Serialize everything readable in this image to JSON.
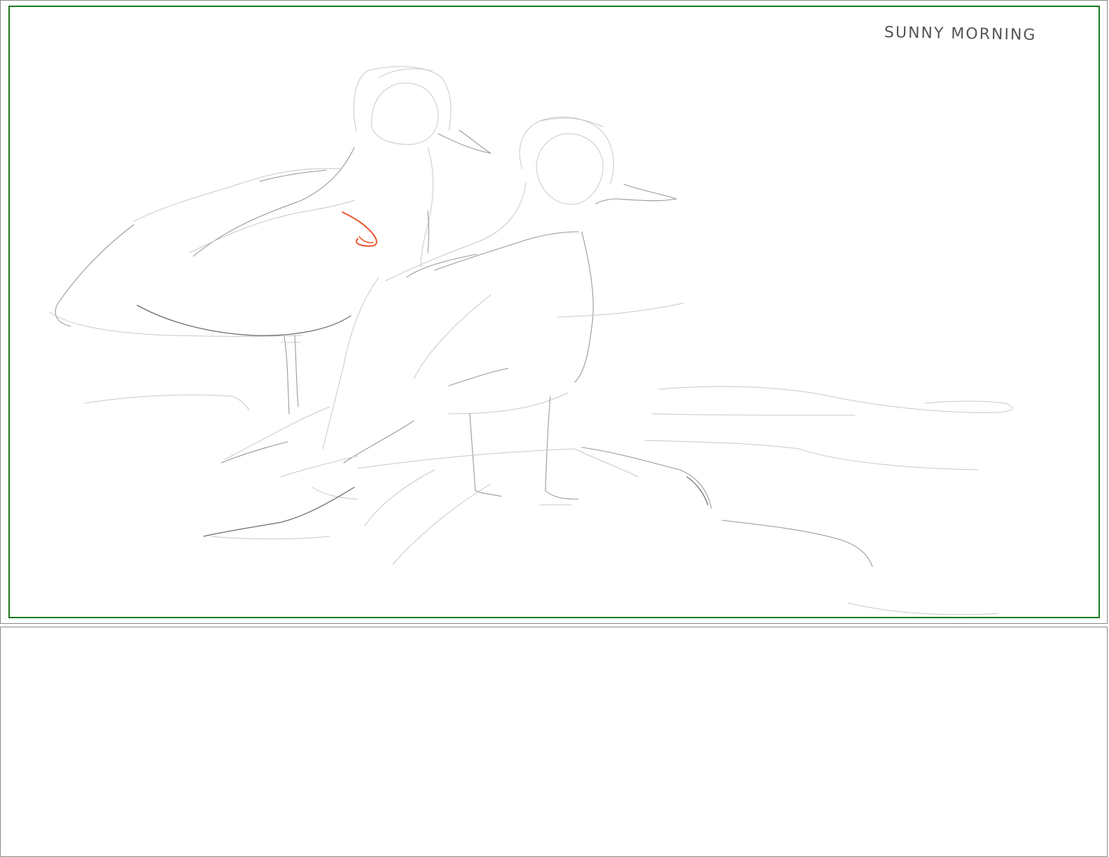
{
  "panels": [
    {
      "caption": "SUNNY MORNING",
      "frame_color": "#1e7a1e",
      "arrow_color": "#e8552f",
      "subject": [
        "bird-left-sketch",
        "bird-right-sketch",
        "rock-sketch",
        "water-lines-sketch"
      ]
    },
    {
      "caption": ""
    }
  ]
}
